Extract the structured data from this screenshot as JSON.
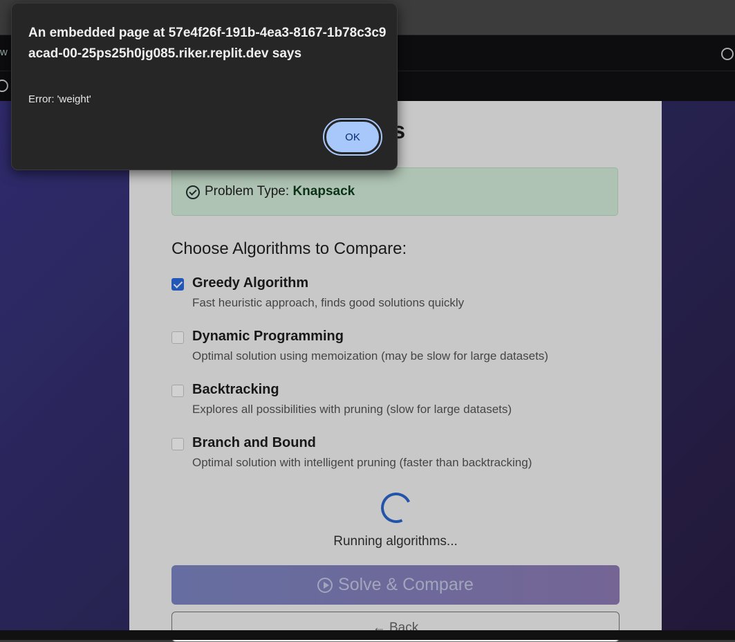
{
  "browser": {
    "left_fragment": "w"
  },
  "page": {
    "title_fragment": "ms",
    "problem_type_label": "Problem Type:",
    "problem_type_value": "Knapsack",
    "choose_heading": "Choose Algorithms to Compare:",
    "algorithms": [
      {
        "name": "Greedy Algorithm",
        "desc": "Fast heuristic approach, finds good solutions quickly",
        "checked": true
      },
      {
        "name": "Dynamic Programming",
        "desc": "Optimal solution using memoization (may be slow for large datasets)",
        "checked": false
      },
      {
        "name": "Backtracking",
        "desc": "Explores all possibilities with pruning (slow for large datasets)",
        "checked": false
      },
      {
        "name": "Branch and Bound",
        "desc": "Optimal solution with intelligent pruning (faster than backtracking)",
        "checked": false
      }
    ],
    "running_text": "Running algorithms...",
    "solve_label": "Solve & Compare",
    "back_label": "← Back"
  },
  "dialog": {
    "heading": "An embedded page at 57e4f26f-191b-4ea3-8167-1b78c3c9acad-00-25ps25h0jg085.riker.replit.dev says",
    "message": "Error: 'weight'",
    "ok_label": "OK"
  }
}
